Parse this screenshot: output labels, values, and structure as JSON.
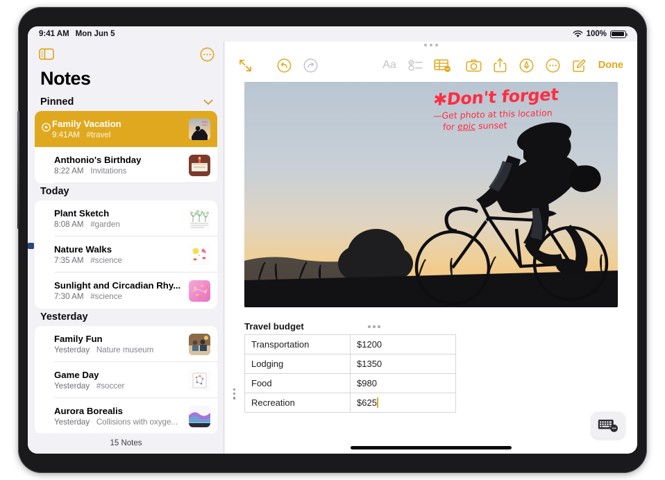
{
  "status_bar": {
    "time": "9:41 AM",
    "date": "Mon Jun 5",
    "battery_percent": "100%",
    "wifi_icon": "wifi-icon",
    "battery_icon": "battery-full-icon"
  },
  "sidebar": {
    "title": "Notes",
    "toggle_icon": "sidebar-toggle-icon",
    "more_icon": "more-circle-icon",
    "footer": "15 Notes",
    "sections": [
      {
        "header": "Pinned",
        "collapse_icon": "chevron-down-icon",
        "items": [
          {
            "title": "Family Vacation",
            "time": "9:41AM",
            "detail": "#travel",
            "selected": true,
            "pinned": true,
            "pin_icon": "pin-clock-icon",
            "thumb": "cyclist-sunset-thumb"
          },
          {
            "title": "Anthonio's Birthday",
            "time": "8:22 AM",
            "detail": "Invitations",
            "selected": false,
            "pinned": false,
            "thumb": "birthday-cake-thumb"
          }
        ]
      },
      {
        "header": "Today",
        "items": [
          {
            "title": "Plant Sketch",
            "time": "8:08 AM",
            "detail": "#garden",
            "selected": false,
            "thumb": "plant-sketch-thumb"
          },
          {
            "title": "Nature Walks",
            "time": "7:35 AM",
            "detail": "#science",
            "selected": false,
            "thumb": "nature-drawing-thumb"
          },
          {
            "title": "Sunlight and Circadian Rhy...",
            "time": "7:30 AM",
            "detail": "#science",
            "selected": false,
            "thumb": "pink-gradient-thumb"
          }
        ]
      },
      {
        "header": "Yesterday",
        "items": [
          {
            "title": "Family Fun",
            "time": "Yesterday",
            "detail": "Nature museum",
            "selected": false,
            "thumb": "family-photo-thumb"
          },
          {
            "title": "Game Day",
            "time": "Yesterday",
            "detail": "#soccer",
            "selected": false,
            "thumb": "soccer-diagram-thumb"
          },
          {
            "title": "Aurora Borealis",
            "time": "Yesterday",
            "detail": "Collisions with oxyge...",
            "selected": false,
            "thumb": "aurora-thumb"
          }
        ]
      }
    ]
  },
  "detail": {
    "multitask_handle": "multitask-handle-icon",
    "toolbar": {
      "expand_icon": "expand-arrows-icon",
      "undo_icon": "undo-icon",
      "redo_icon": "redo-icon",
      "format_label": "Aa",
      "checklist_icon": "checklist-icon",
      "table_icon": "table-icon",
      "camera_icon": "camera-icon",
      "share_icon": "share-icon",
      "markup_icon": "markup-pen-icon",
      "more_icon": "more-circle-icon",
      "compose_icon": "compose-icon",
      "done_label": "Done"
    },
    "photo": {
      "alt": "cyclist-silhouette-at-sunset",
      "annotation": {
        "star": "✱",
        "title": "Don't forget",
        "line1": "—Get photo at this location",
        "line2_pre": "for ",
        "line2_emphasis": "epic",
        "line2_post": " sunset",
        "color": "#ff2d42"
      }
    },
    "table": {
      "title": "Travel budget",
      "menu_icon": "table-menu-dots-icon",
      "row_handle_icon": "row-drag-handle-icon",
      "rows": [
        {
          "label": "Transportation",
          "value": "$1200"
        },
        {
          "label": "Lodging",
          "value": "$1350"
        },
        {
          "label": "Food",
          "value": "$980"
        },
        {
          "label": "Recreation",
          "value": "$625",
          "cursor": true
        }
      ]
    },
    "keyboard_button_icon": "keyboard-dismiss-icon"
  },
  "colors": {
    "accent": "#e0a81e",
    "annotation": "#ff2d42",
    "sidebar_bg": "#f2f1f6",
    "card_bg": "#ffffff"
  }
}
